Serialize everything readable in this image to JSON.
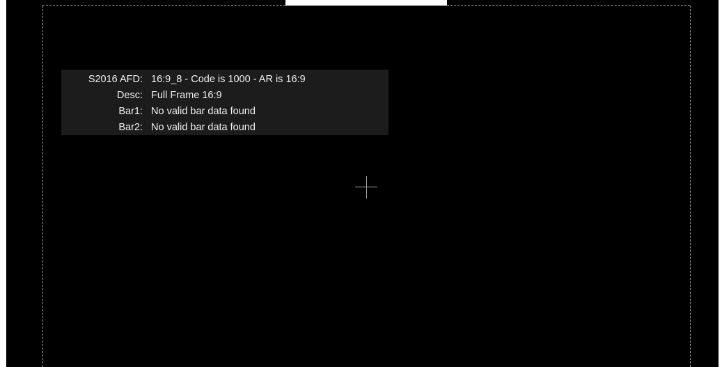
{
  "afd_panel": {
    "rows": [
      {
        "label": "S2016 AFD:",
        "value": "16:9_8 - Code is 1000 - AR is 16:9"
      },
      {
        "label": "Desc:",
        "value": "Full Frame 16:9"
      },
      {
        "label": "Bar1:",
        "value": "No valid bar data found"
      },
      {
        "label": "Bar2:",
        "value": "No valid bar data found"
      }
    ]
  },
  "colors": {
    "background": "#000000",
    "panel": "#1c1c1c",
    "text": "#f0f0f0",
    "safe_area_line": "#9a9a9a"
  },
  "overlay": {
    "safe_area_marker": "dashed-safe-area-icon",
    "center_marker": "crosshair-icon"
  }
}
